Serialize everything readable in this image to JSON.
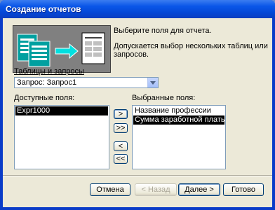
{
  "window": {
    "title": "Создание отчетов"
  },
  "intro": {
    "line1": "Выберите поля для отчета.",
    "line2": "Допускается выбор нескольких таблиц или запросов."
  },
  "source": {
    "label": "Таблицы и запросы",
    "selected": "Запрос: Запрос1"
  },
  "available": {
    "label": "Доступные поля:",
    "items": [
      "Expr1000"
    ]
  },
  "chosen": {
    "label": "Выбранные поля:",
    "items": [
      "Название профессии",
      "Сумма заработной платы по табе"
    ]
  },
  "move_buttons": {
    "add": ">",
    "add_all": ">>",
    "remove": "<",
    "remove_all": "<<"
  },
  "footer": {
    "cancel": "Отмена",
    "back": "< Назад",
    "next": "Далее >",
    "finish": "Готово"
  },
  "colors": {
    "titlebar": "#0a56e8",
    "client": "#ece9d8",
    "selection": "#000000"
  }
}
